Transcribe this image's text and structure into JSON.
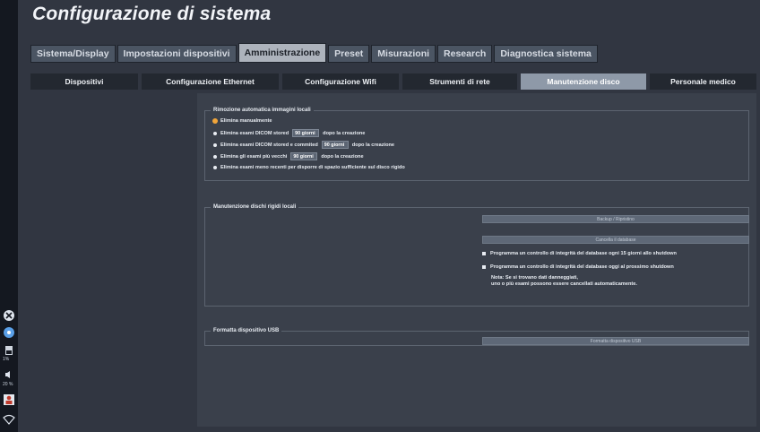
{
  "title": "Configurazione di sistema",
  "tabs": [
    {
      "label": "Sistema/Display",
      "active": false
    },
    {
      "label": "Impostazioni dispositivi",
      "active": false
    },
    {
      "label": "Amministrazione",
      "active": true
    },
    {
      "label": "Preset",
      "active": false
    },
    {
      "label": "Misurazioni",
      "active": false
    },
    {
      "label": "Research",
      "active": false
    },
    {
      "label": "Diagnostica sistema",
      "active": false
    }
  ],
  "subtabs": [
    {
      "label": "Dispositivi",
      "active": false
    },
    {
      "label": "Configurazione Ethernet",
      "active": false
    },
    {
      "label": "Configurazione Wifi",
      "active": false
    },
    {
      "label": "Strumenti di rete",
      "active": false
    },
    {
      "label": "Manutenzione disco",
      "active": true
    },
    {
      "label": "Personale medico",
      "active": false
    }
  ],
  "auto_removal": {
    "legend": "Rimozione automatica immagini locali",
    "opt_manual": "Elimina manualmente",
    "opt_stored_pre": "Elimina esami DICOM stored",
    "opt_stored_val": "90 giorni",
    "opt_stored_post": "dopo la creazione",
    "opt_committed_pre": "Elimina esami DICOM stored e commited",
    "opt_committed_val": "90 giorni",
    "opt_committed_post": "dopo la creazione",
    "opt_oldest_pre": "Elimina gli esami più vecchi",
    "opt_oldest_val": "90 giorni",
    "opt_oldest_post": "dopo la creazione",
    "opt_space": "Elimina esami meno recenti per disporre di spazio sufficiente sul disco rigido"
  },
  "disk_maint": {
    "legend": "Manutenzione dischi rigidi locali",
    "backup_btn": "Backup / Ripristino",
    "clear_btn": "Cancella il database",
    "check_15": "Programma un controllo di integrità del database ogni 15 giorni allo shutdown",
    "check_today": "Programma un controllo di integrità del database oggi al prossimo shutdown",
    "note_line1": "Nota: Se si trovano dati danneggiati,",
    "note_line2": "uno o più esami possono essere cancellati automaticamente."
  },
  "usb": {
    "legend": "Formatta dispositivo USB",
    "format_btn": "Formatta dispositivo USB"
  },
  "leftbar": {
    "label_a": "1%",
    "label_b": "20 %"
  }
}
